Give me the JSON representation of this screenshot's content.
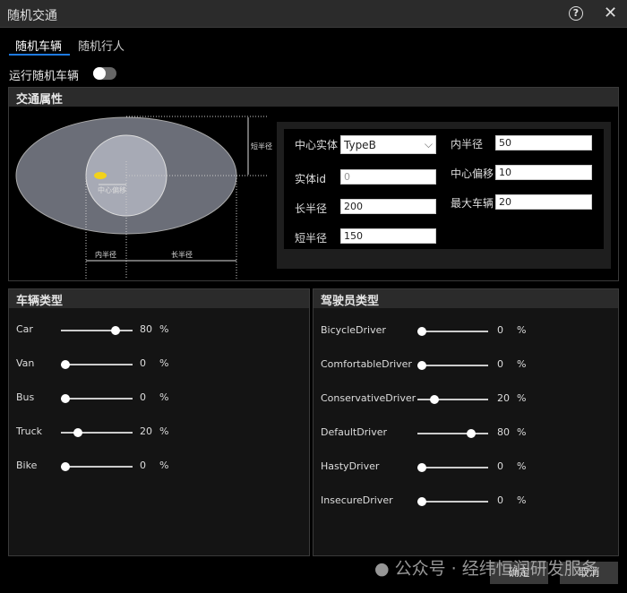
{
  "window": {
    "title": "随机交通",
    "help_icon": "help-icon",
    "close_icon": "close-icon"
  },
  "tabs": [
    {
      "label": "随机车辆",
      "active": true
    },
    {
      "label": "随机行人",
      "active": false
    }
  ],
  "toggle": {
    "label": "运行随机车辆",
    "on": false
  },
  "traffic": {
    "title": "交通属性",
    "diagram": {
      "short_radius": "短半径",
      "center_offset": "中心偏移",
      "inner_radius": "内半径",
      "long_radius": "长半径"
    },
    "fields": {
      "center_entity": {
        "label": "中心实体",
        "value": "TypeB"
      },
      "entity_id": {
        "label": "实体id",
        "value": "0"
      },
      "long_radius": {
        "label": "长半径",
        "value": "200"
      },
      "short_radius": {
        "label": "短半径",
        "value": "150"
      },
      "inner_radius": {
        "label": "内半径",
        "value": "50"
      },
      "center_offset": {
        "label": "中心偏移",
        "value": "10"
      },
      "max_vehicles": {
        "label": "最大车辆",
        "value": "20"
      }
    }
  },
  "vehicle_types": {
    "title": "车辆类型",
    "items": [
      {
        "name": "Car",
        "value": 80,
        "unit": "%"
      },
      {
        "name": "Van",
        "value": 0,
        "unit": "%"
      },
      {
        "name": "Bus",
        "value": 0,
        "unit": "%"
      },
      {
        "name": "Truck",
        "value": 20,
        "unit": "%"
      },
      {
        "name": "Bike",
        "value": 0,
        "unit": "%"
      }
    ]
  },
  "driver_types": {
    "title": "驾驶员类型",
    "items": [
      {
        "name": "BicycleDriver",
        "value": 0,
        "unit": "%"
      },
      {
        "name": "ComfortableDriver",
        "value": 0,
        "unit": "%"
      },
      {
        "name": "ConservativeDriver",
        "value": 20,
        "unit": "%"
      },
      {
        "name": "DefaultDriver",
        "value": 80,
        "unit": "%"
      },
      {
        "name": "HastyDriver",
        "value": 0,
        "unit": "%"
      },
      {
        "name": "InsecureDriver",
        "value": 0,
        "unit": "%"
      }
    ]
  },
  "buttons": {
    "ok": "确定",
    "cancel": "取消"
  },
  "watermark": "公众号 · 经纬恒润研发服务"
}
